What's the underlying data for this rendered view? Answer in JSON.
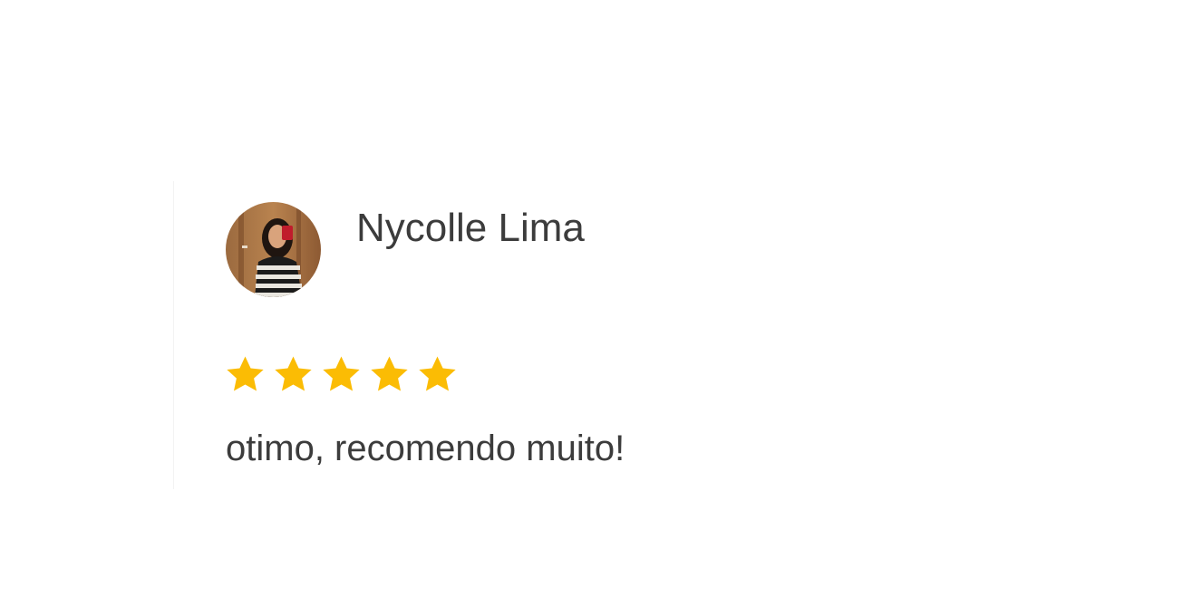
{
  "review": {
    "reviewer": {
      "name": "Nycolle Lima",
      "avatar_icon": "profile-photo"
    },
    "rating": {
      "value": 5,
      "max": 5,
      "star_icon": "star-icon",
      "star_color": "#FBBC04"
    },
    "text": "otimo, recomendo muito!"
  }
}
